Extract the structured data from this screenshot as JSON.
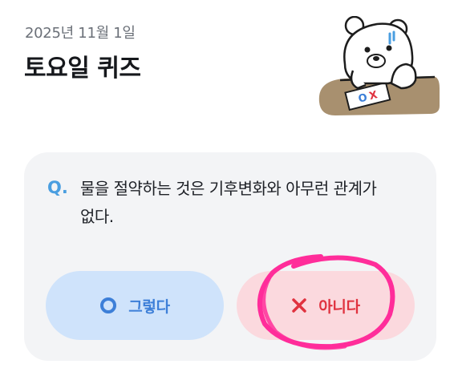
{
  "header": {
    "date": "2025년 11월 1일",
    "title": "토요일 퀴즈"
  },
  "quiz": {
    "q_mark": "Q.",
    "question_line1": "물을 절약하는 것은 기후변화와 아무런 관계가",
    "question_line2": "없다."
  },
  "answers": {
    "yes_label": "그렇다",
    "yes_icon": "circle-o-icon",
    "no_label": "아니다",
    "no_icon": "x-icon",
    "paper_marks": "OX"
  },
  "colors": {
    "accent_blue": "#3d7fd8",
    "accent_red": "#e0323f",
    "annotation_pink": "#ff2d9a"
  }
}
